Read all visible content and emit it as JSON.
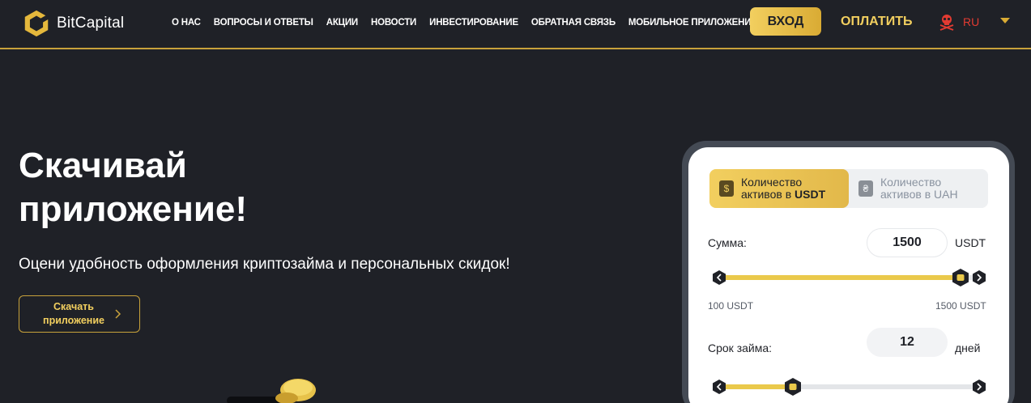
{
  "header": {
    "brand": "BitCapital",
    "nav": [
      "О НАС",
      "ВОПРОСЫ И ОТВЕТЫ",
      "АКЦИИ",
      "НОВОСТИ",
      "ИНВЕСТИРОВАНИЕ",
      "ОБРАТНАЯ СВЯЗЬ",
      "МОБИЛЬНОЕ ПРИЛОЖЕНИЕ"
    ],
    "login_label": "ВХОД",
    "pay_label": "ОПЛАТИТЬ",
    "language": "RU"
  },
  "hero": {
    "title": "Скачивай приложение!",
    "subtitle": "Оцени удобность оформления криптозайма и персональных скидок!",
    "download_label": "Скачать приложение"
  },
  "calculator": {
    "tabs": [
      {
        "icon": "$",
        "line1": "Количество",
        "line2_prefix": "активов в ",
        "line2_bold": "USDT",
        "active": true
      },
      {
        "icon": "₴",
        "line1": "Количество",
        "line2_prefix": "активов в UAH",
        "line2_bold": "",
        "active": false
      }
    ],
    "amount": {
      "label": "Сумма:",
      "value": "1500",
      "unit": "USDT",
      "min_label": "100 USDT",
      "max_label": "1500 USDT",
      "fraction": 1.0
    },
    "term": {
      "label": "Срок займа:",
      "value": "12",
      "unit": "дней",
      "fraction": 0.31
    }
  },
  "colors": {
    "background": "#1f2127",
    "accent": "#f2cf5f",
    "accent_dark": "#d9ab34",
    "language_red": "#e23b32"
  }
}
